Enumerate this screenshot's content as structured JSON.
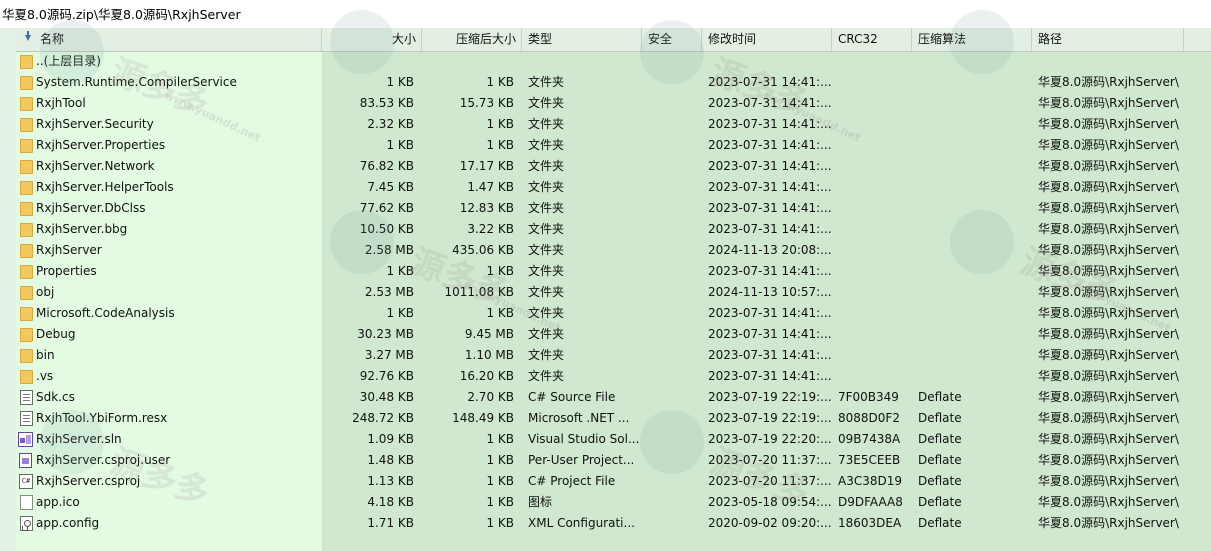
{
  "path_bar": {
    "path": "华夏8.0源码.zip\\华夏8.0源码\\RxjhServer"
  },
  "columns": {
    "name": "名称",
    "size": "大小",
    "compressed": "压缩后大小",
    "type": "类型",
    "security": "安全",
    "modified": "修改时间",
    "crc": "CRC32",
    "algorithm": "压缩算法",
    "path": "路径"
  },
  "watermark": {
    "text": "源多多",
    "url": "www.yuandd.net"
  },
  "rows": [
    {
      "icon": "folder-icon",
      "name": "..(上层目录)",
      "size": "",
      "compressed": "",
      "type": "",
      "security": "",
      "modified": "",
      "crc": "",
      "algorithm": "",
      "path": ""
    },
    {
      "icon": "folder-icon",
      "name": "System.Runtime.CompilerService",
      "size": "1 KB",
      "compressed": "1 KB",
      "type": "文件夹",
      "security": "",
      "modified": "2023-07-31 14:41:...",
      "crc": "",
      "algorithm": "",
      "path": "华夏8.0源码\\RxjhServer\\"
    },
    {
      "icon": "folder-icon",
      "name": "RxjhTool",
      "size": "83.53 KB",
      "compressed": "15.73 KB",
      "type": "文件夹",
      "security": "",
      "modified": "2023-07-31 14:41:...",
      "crc": "",
      "algorithm": "",
      "path": "华夏8.0源码\\RxjhServer\\"
    },
    {
      "icon": "folder-icon",
      "name": "RxjhServer.Security",
      "size": "2.32 KB",
      "compressed": "1 KB",
      "type": "文件夹",
      "security": "",
      "modified": "2023-07-31 14:41:...",
      "crc": "",
      "algorithm": "",
      "path": "华夏8.0源码\\RxjhServer\\"
    },
    {
      "icon": "folder-icon",
      "name": "RxjhServer.Properties",
      "size": "1 KB",
      "compressed": "1 KB",
      "type": "文件夹",
      "security": "",
      "modified": "2023-07-31 14:41:...",
      "crc": "",
      "algorithm": "",
      "path": "华夏8.0源码\\RxjhServer\\"
    },
    {
      "icon": "folder-icon",
      "name": "RxjhServer.Network",
      "size": "76.82 KB",
      "compressed": "17.17 KB",
      "type": "文件夹",
      "security": "",
      "modified": "2023-07-31 14:41:...",
      "crc": "",
      "algorithm": "",
      "path": "华夏8.0源码\\RxjhServer\\"
    },
    {
      "icon": "folder-icon",
      "name": "RxjhServer.HelperTools",
      "size": "7.45 KB",
      "compressed": "1.47 KB",
      "type": "文件夹",
      "security": "",
      "modified": "2023-07-31 14:41:...",
      "crc": "",
      "algorithm": "",
      "path": "华夏8.0源码\\RxjhServer\\"
    },
    {
      "icon": "folder-icon",
      "name": "RxjhServer.DbClss",
      "size": "77.62 KB",
      "compressed": "12.83 KB",
      "type": "文件夹",
      "security": "",
      "modified": "2023-07-31 14:41:...",
      "crc": "",
      "algorithm": "",
      "path": "华夏8.0源码\\RxjhServer\\"
    },
    {
      "icon": "folder-icon",
      "name": "RxjhServer.bbg",
      "size": "10.50 KB",
      "compressed": "3.22 KB",
      "type": "文件夹",
      "security": "",
      "modified": "2023-07-31 14:41:...",
      "crc": "",
      "algorithm": "",
      "path": "华夏8.0源码\\RxjhServer\\"
    },
    {
      "icon": "folder-icon",
      "name": "RxjhServer",
      "size": "2.58 MB",
      "compressed": "435.06 KB",
      "type": "文件夹",
      "security": "",
      "modified": "2024-11-13 20:08:...",
      "crc": "",
      "algorithm": "",
      "path": "华夏8.0源码\\RxjhServer\\"
    },
    {
      "icon": "folder-icon",
      "name": "Properties",
      "size": "1 KB",
      "compressed": "1 KB",
      "type": "文件夹",
      "security": "",
      "modified": "2023-07-31 14:41:...",
      "crc": "",
      "algorithm": "",
      "path": "华夏8.0源码\\RxjhServer\\"
    },
    {
      "icon": "folder-icon",
      "name": "obj",
      "size": "2.53 MB",
      "compressed": "1011.08 KB",
      "type": "文件夹",
      "security": "",
      "modified": "2024-11-13 10:57:...",
      "crc": "",
      "algorithm": "",
      "path": "华夏8.0源码\\RxjhServer\\"
    },
    {
      "icon": "folder-icon",
      "name": "Microsoft.CodeAnalysis",
      "size": "1 KB",
      "compressed": "1 KB",
      "type": "文件夹",
      "security": "",
      "modified": "2023-07-31 14:41:...",
      "crc": "",
      "algorithm": "",
      "path": "华夏8.0源码\\RxjhServer\\"
    },
    {
      "icon": "folder-icon",
      "name": "Debug",
      "size": "30.23 MB",
      "compressed": "9.45 MB",
      "type": "文件夹",
      "security": "",
      "modified": "2023-07-31 14:41:...",
      "crc": "",
      "algorithm": "",
      "path": "华夏8.0源码\\RxjhServer\\"
    },
    {
      "icon": "folder-icon",
      "name": "bin",
      "size": "3.27 MB",
      "compressed": "1.10 MB",
      "type": "文件夹",
      "security": "",
      "modified": "2023-07-31 14:41:...",
      "crc": "",
      "algorithm": "",
      "path": "华夏8.0源码\\RxjhServer\\"
    },
    {
      "icon": "folder-icon",
      "name": ".vs",
      "size": "92.76 KB",
      "compressed": "16.20 KB",
      "type": "文件夹",
      "security": "",
      "modified": "2023-07-31 14:41:...",
      "crc": "",
      "algorithm": "",
      "path": "华夏8.0源码\\RxjhServer\\"
    },
    {
      "icon": "file-icon",
      "name": "Sdk.cs",
      "size": "30.48 KB",
      "compressed": "2.70 KB",
      "type": "C# Source File",
      "security": "",
      "modified": "2023-07-19 22:19:...",
      "crc": "7F00B349",
      "algorithm": "Deflate",
      "path": "华夏8.0源码\\RxjhServer\\"
    },
    {
      "icon": "file-icon",
      "name": "RxjhTool.YbiForm.resx",
      "size": "248.72 KB",
      "compressed": "148.49 KB",
      "type": "Microsoft .NET ...",
      "security": "",
      "modified": "2023-07-19 22:19:...",
      "crc": "8088D0F2",
      "algorithm": "Deflate",
      "path": "华夏8.0源码\\RxjhServer\\"
    },
    {
      "icon": "sln-icon",
      "name": "RxjhServer.sln",
      "size": "1.09 KB",
      "compressed": "1 KB",
      "type": "Visual Studio Sol...",
      "security": "",
      "modified": "2023-07-19 22:20:...",
      "crc": "09B7438A",
      "algorithm": "Deflate",
      "path": "华夏8.0源码\\RxjhServer\\"
    },
    {
      "icon": "user-icon",
      "name": "RxjhServer.csproj.user",
      "size": "1.48 KB",
      "compressed": "1 KB",
      "type": "Per-User Project...",
      "security": "",
      "modified": "2023-07-20 11:37:...",
      "crc": "73E5CEEB",
      "algorithm": "Deflate",
      "path": "华夏8.0源码\\RxjhServer\\"
    },
    {
      "icon": "csproj-icon",
      "name": "RxjhServer.csproj",
      "size": "1.13 KB",
      "compressed": "1 KB",
      "type": "C# Project File",
      "security": "",
      "modified": "2023-07-20 11:37:...",
      "crc": "A3C38D19",
      "algorithm": "Deflate",
      "path": "华夏8.0源码\\RxjhServer\\"
    },
    {
      "icon": "ico-icon",
      "name": "app.ico",
      "size": "4.18 KB",
      "compressed": "1 KB",
      "type": "图标",
      "security": "",
      "modified": "2023-05-18 09:54:...",
      "crc": "D9DFAAA8",
      "algorithm": "Deflate",
      "path": "华夏8.0源码\\RxjhServer\\"
    },
    {
      "icon": "config-icon",
      "name": "app.config",
      "size": "1.71 KB",
      "compressed": "1 KB",
      "type": "XML Configurati...",
      "security": "",
      "modified": "2020-09-02 09:20:...",
      "crc": "18603DEA",
      "algorithm": "Deflate",
      "path": "华夏8.0源码\\RxjhServer\\"
    }
  ]
}
